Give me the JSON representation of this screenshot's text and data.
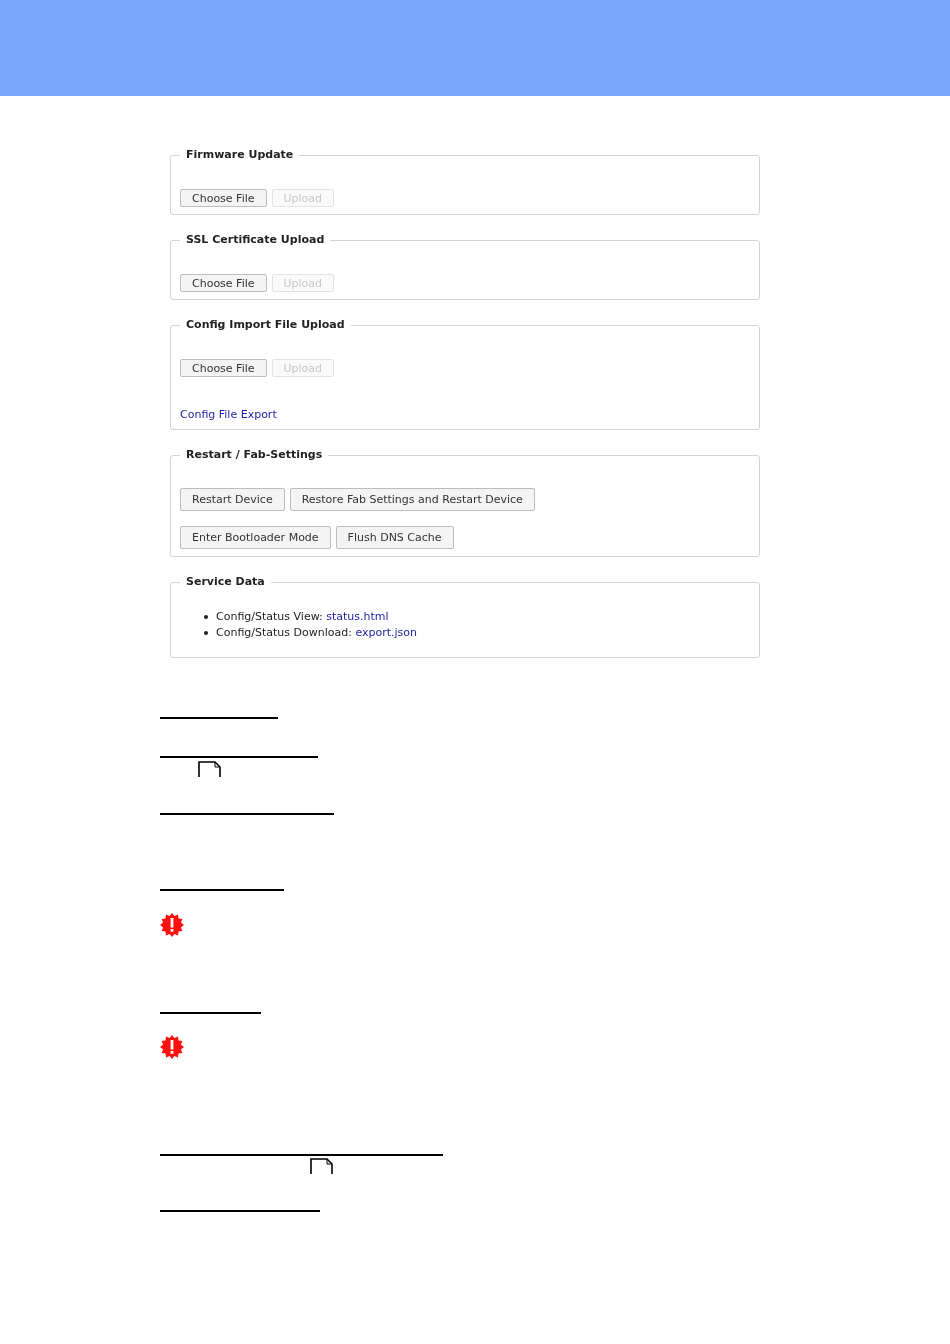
{
  "sections": [
    {
      "kind": "upload",
      "legend": "Firmware Update",
      "buttons": [
        {
          "label": "Choose File",
          "disabled": false
        },
        {
          "label": "Upload",
          "disabled": true
        }
      ]
    },
    {
      "kind": "upload",
      "legend": "SSL Certificate Upload",
      "buttons": [
        {
          "label": "Choose File",
          "disabled": false
        },
        {
          "label": "Upload",
          "disabled": true
        }
      ]
    },
    {
      "kind": "upload",
      "legend": "Config Import File Upload",
      "buttons": [
        {
          "label": "Choose File",
          "disabled": false
        },
        {
          "label": "Upload",
          "disabled": true
        }
      ],
      "link": "Config File Export"
    },
    {
      "kind": "buttons",
      "legend": "Restart / Fab-Settings",
      "rows": [
        [
          "Restart Device",
          "Restore Fab Settings and Restart Device"
        ],
        [
          "Enter Bootloader Mode",
          "Flush DNS Cache"
        ]
      ]
    },
    {
      "kind": "list",
      "legend": "Service Data",
      "items": [
        {
          "text": "Config/Status View:",
          "link": "status.html"
        },
        {
          "text": "Config/Status Download:",
          "link": "export.json"
        }
      ]
    }
  ]
}
